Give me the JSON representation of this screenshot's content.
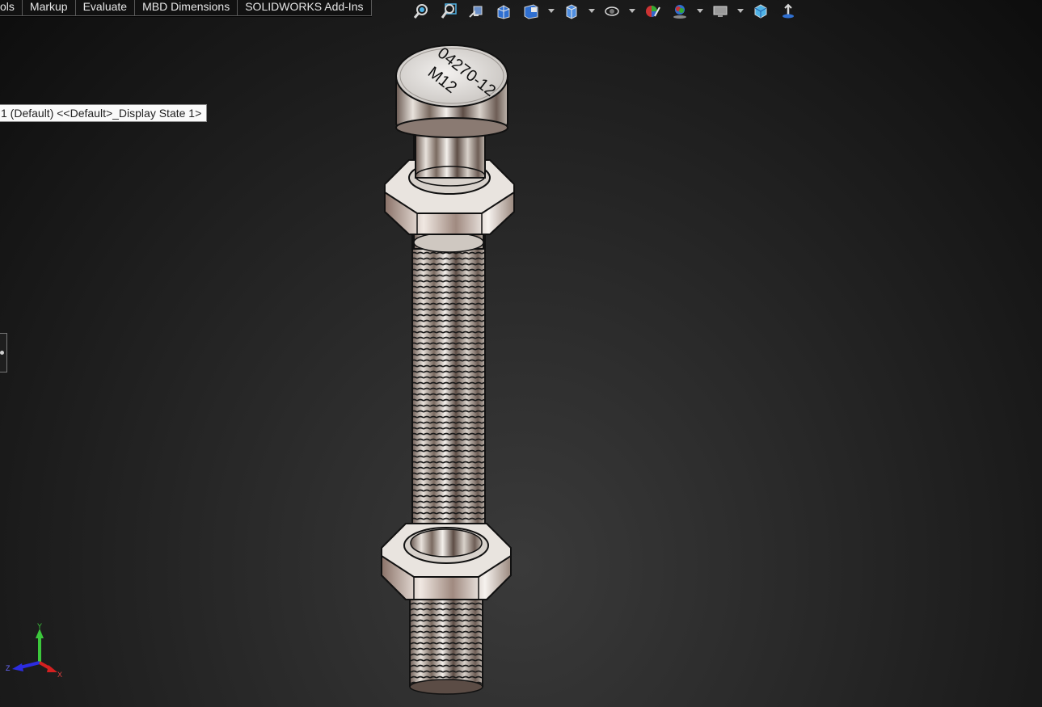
{
  "tabs": [
    {
      "label": "ols"
    },
    {
      "label": "Markup"
    },
    {
      "label": "Evaluate"
    },
    {
      "label": "MBD Dimensions"
    },
    {
      "label": "SOLIDWORKS Add-Ins"
    }
  ],
  "heads_up_toolbar": {
    "icons": [
      "zoom-to-fit-icon",
      "zoom-to-area-icon",
      "previous-view-icon",
      "section-view-icon",
      "dynamic-annotation-view-icon",
      "view-orientation-icon",
      "display-style-icon",
      "hide-show-items-icon",
      "edit-appearance-icon",
      "apply-scene-icon",
      "view-settings-icon",
      "display-pane-icon"
    ],
    "colors": {
      "blue": "#2f6fd0",
      "cyan": "#4fb3e6",
      "white": "#e8e8e8"
    }
  },
  "config_label": {
    "text": "1 (Default) <<Default>_Display State 1>"
  },
  "model": {
    "engraving_line1": "04270-12",
    "engraving_line2": "M12"
  },
  "triad": {
    "x_label": "X",
    "y_label": "Y",
    "z_label": "Z",
    "colors": {
      "x": "#d42020",
      "y": "#3cc83c",
      "z": "#2c2ce0"
    }
  }
}
